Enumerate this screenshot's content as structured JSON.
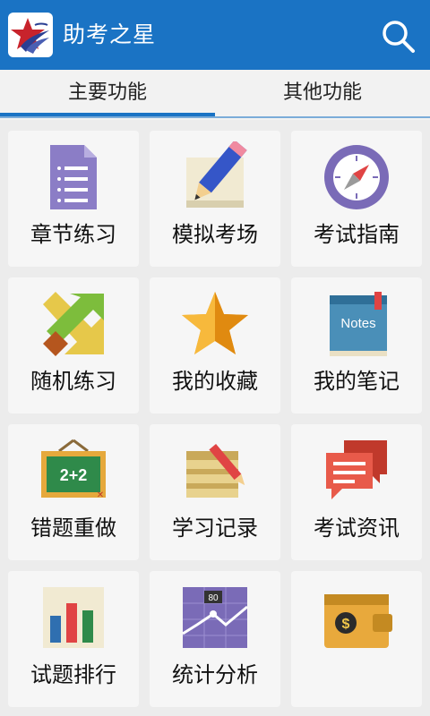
{
  "app": {
    "title": "助考之星"
  },
  "tabs": [
    {
      "label": "主要功能"
    },
    {
      "label": "其他功能"
    }
  ],
  "tiles": [
    {
      "label": "章节练习",
      "icon": "document-list-icon"
    },
    {
      "label": "模拟考场",
      "icon": "pencil-paper-icon"
    },
    {
      "label": "考试指南",
      "icon": "compass-icon"
    },
    {
      "label": "随机练习",
      "icon": "shuffle-arrows-icon"
    },
    {
      "label": "我的收藏",
      "icon": "star-icon"
    },
    {
      "label": "我的笔记",
      "icon": "notes-book-icon",
      "icon_text": "Notes"
    },
    {
      "label": "错题重做",
      "icon": "chalkboard-icon",
      "icon_text": "2+2"
    },
    {
      "label": "学习记录",
      "icon": "notepad-pencil-icon"
    },
    {
      "label": "考试资讯",
      "icon": "chat-bubbles-icon"
    },
    {
      "label": "试题排行",
      "icon": "bar-chart-icon"
    },
    {
      "label": "统计分析",
      "icon": "line-graph-icon",
      "icon_text": "80"
    },
    {
      "label": "",
      "icon": "wallet-icon",
      "icon_text": "$"
    }
  ],
  "colors": {
    "appbar": "#1a73c4",
    "tile_bg": "#f6f6f6",
    "page_bg": "#ececec"
  }
}
